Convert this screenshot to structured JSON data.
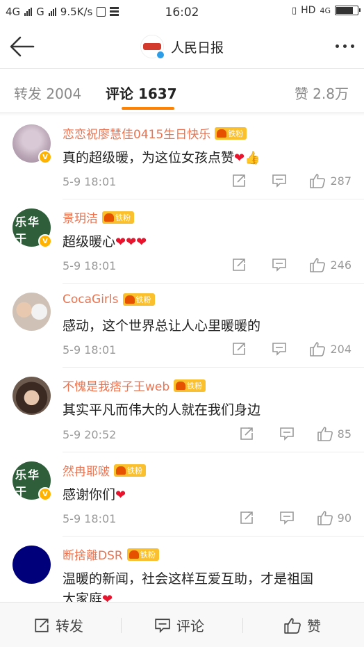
{
  "status_bar": {
    "left": "4G ıll G ıll 9.5K/s",
    "net1": "4G",
    "net2": "G",
    "speed": "9.5K/s",
    "time": "16:02",
    "hd": "HD",
    "net3": "4G"
  },
  "header": {
    "title": "人民日报"
  },
  "tabs": {
    "repost": "转发 2004",
    "comment": "评论 1637",
    "like": "赞 2.8万"
  },
  "comments": [
    {
      "name": "恋恋祝廖慧佳0415生日快乐",
      "badge": "铁粉",
      "text": "真的超级暖，为这位女孩点赞",
      "emoji": "❤👍",
      "time": "5-9 18:01",
      "likes": "287"
    },
    {
      "name": "景玥洁",
      "badge": "铁粉",
      "text": "超级暖心",
      "emoji": "❤❤❤",
      "time": "5-9 18:01",
      "likes": "246"
    },
    {
      "name": "CocaGirls",
      "badge": "铁粉",
      "text": "感动，这个世界总让人心里暖暖的",
      "emoji": "",
      "time": "5-9 18:01",
      "likes": "204"
    },
    {
      "name": "不愧是我痞子王web",
      "badge": "铁粉",
      "text": "其实平凡而伟大的人就在我们身边",
      "emoji": "",
      "time": "5-9 20:52",
      "likes": "85"
    },
    {
      "name": "然冉耶啵",
      "badge": "铁粉",
      "text": "感谢你们",
      "emoji": "❤",
      "time": "5-9 18:01",
      "likes": "90"
    },
    {
      "name": "断捨離DSR",
      "badge": "铁粉",
      "text": "温暖的新闻，社会这样互爱互助，才是祖国",
      "text2": "大家庭",
      "emoji": "❤",
      "time": "",
      "likes": ""
    }
  ],
  "bottom_bar": {
    "repost": "转发",
    "comment": "评论",
    "like": "赞"
  },
  "colors": {
    "accent": "#ff8200",
    "name": "#eb7350",
    "heart": "#e8132c"
  }
}
